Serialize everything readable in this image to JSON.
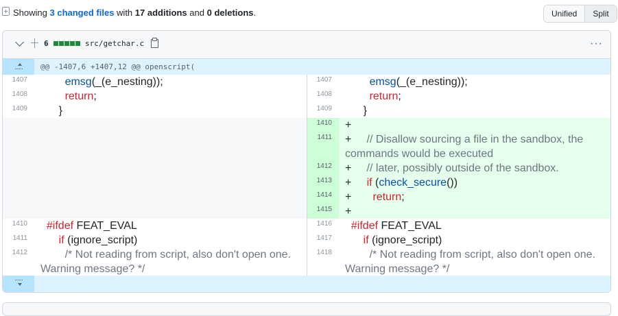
{
  "summary": {
    "showing": "Showing",
    "changed_files": "3 changed files",
    "with": "with",
    "additions": "17 additions",
    "and": "and",
    "deletions": "0 deletions",
    "period": ".",
    "view_unified": "Unified",
    "view_split": "Split"
  },
  "file": {
    "change_count": "6",
    "name": "src/getchar.c",
    "menu": "···",
    "hunk_header": "@@ -1407,6 +1407,12 @@ openscript("
  },
  "left_lines": [
    {
      "num": "1407",
      "indent": "        ",
      "parts": [
        {
          "t": "emsg",
          "c": "fn"
        },
        {
          "t": "(_(e_nesting));",
          "c": ""
        }
      ]
    },
    {
      "num": "1408",
      "indent": "        ",
      "parts": [
        {
          "t": "return",
          "c": "kw"
        },
        {
          "t": ";",
          "c": ""
        }
      ]
    },
    {
      "num": "1409",
      "indent": "      ",
      "parts": [
        {
          "t": "}",
          "c": ""
        }
      ]
    },
    {
      "num": "",
      "empty": true
    },
    {
      "num": "",
      "empty": true,
      "tall": true
    },
    {
      "num": "",
      "empty": true
    },
    {
      "num": "",
      "empty": true
    },
    {
      "num": "",
      "empty": true
    },
    {
      "num": "",
      "empty": true
    },
    {
      "num": "1410",
      "indent": "  ",
      "parts": [
        {
          "t": "#ifdef",
          "c": "pre"
        },
        {
          "t": " FEAT_EVAL",
          "c": ""
        }
      ]
    },
    {
      "num": "1411",
      "indent": "      ",
      "parts": [
        {
          "t": "if",
          "c": "kw"
        },
        {
          "t": " (ignore_script)",
          "c": ""
        }
      ]
    },
    {
      "num": "1412",
      "indent": "        ",
      "tall": true,
      "parts": [
        {
          "t": "/* Not reading from script, also don't open one. Warning message? */",
          "c": "cm"
        }
      ]
    }
  ],
  "right_lines": [
    {
      "num": "1407",
      "indent": "        ",
      "parts": [
        {
          "t": "emsg",
          "c": "fn"
        },
        {
          "t": "(_(e_nesting));",
          "c": ""
        }
      ]
    },
    {
      "num": "1408",
      "indent": "        ",
      "parts": [
        {
          "t": "return",
          "c": "kw"
        },
        {
          "t": ";",
          "c": ""
        }
      ]
    },
    {
      "num": "1409",
      "indent": "      ",
      "parts": [
        {
          "t": "}",
          "c": ""
        }
      ]
    },
    {
      "num": "1410",
      "add": true,
      "indent": "",
      "parts": [
        {
          "t": "+",
          "c": ""
        }
      ]
    },
    {
      "num": "1411",
      "add": true,
      "tall": true,
      "indent": "",
      "parts": [
        {
          "t": "+     ",
          "c": ""
        },
        {
          "t": "// Disallow sourcing a file in the sandbox, the commands would be executed",
          "c": "cm"
        }
      ]
    },
    {
      "num": "1412",
      "add": true,
      "indent": "",
      "parts": [
        {
          "t": "+     ",
          "c": ""
        },
        {
          "t": "// later, possibly outside of the sandbox.",
          "c": "cm"
        }
      ]
    },
    {
      "num": "1413",
      "add": true,
      "indent": "",
      "parts": [
        {
          "t": "+     ",
          "c": ""
        },
        {
          "t": "if",
          "c": "kw"
        },
        {
          "t": " (",
          "c": ""
        },
        {
          "t": "check_secure",
          "c": "fn"
        },
        {
          "t": "())",
          "c": ""
        }
      ]
    },
    {
      "num": "1414",
      "add": true,
      "indent": "",
      "parts": [
        {
          "t": "+       ",
          "c": ""
        },
        {
          "t": "return",
          "c": "kw"
        },
        {
          "t": ";",
          "c": ""
        }
      ]
    },
    {
      "num": "1415",
      "add": true,
      "indent": "",
      "parts": [
        {
          "t": "+",
          "c": ""
        }
      ]
    },
    {
      "num": "1416",
      "indent": "  ",
      "parts": [
        {
          "t": "#ifdef",
          "c": "pre"
        },
        {
          "t": " FEAT_EVAL",
          "c": ""
        }
      ]
    },
    {
      "num": "1417",
      "indent": "      ",
      "parts": [
        {
          "t": "if",
          "c": "kw"
        },
        {
          "t": " (ignore_script)",
          "c": ""
        }
      ]
    },
    {
      "num": "1418",
      "indent": "        ",
      "tall": true,
      "parts": [
        {
          "t": "/* Not reading from script, also don't open one. Warning message? */",
          "c": "cm"
        }
      ]
    }
  ],
  "colors": {
    "addition_bg": "#e6ffec",
    "addition_gutter": "#ccffd8",
    "hunk_bg": "#ddf4ff",
    "link": "#0969da"
  }
}
